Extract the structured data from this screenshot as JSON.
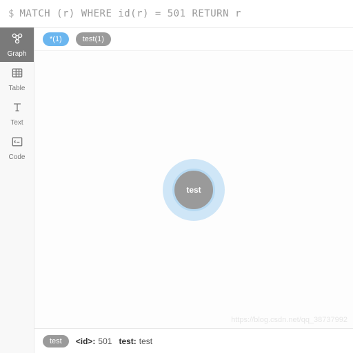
{
  "query": {
    "prompt": "$",
    "text": "MATCH (r) WHERE id(r) = 501 RETURN r"
  },
  "sidebar": {
    "items": [
      {
        "label": "Graph"
      },
      {
        "label": "Table"
      },
      {
        "label": "Text"
      },
      {
        "label": "Code"
      }
    ]
  },
  "chips": {
    "all": "*(1)",
    "label": "test(1)"
  },
  "node": {
    "label": "test"
  },
  "footer": {
    "label_chip": "test",
    "id_key": "<id>:",
    "id_val": "501",
    "prop_key": "test:",
    "prop_val": "test"
  },
  "watermark": "https://blog.csdn.net/qq_38737992",
  "colors": {
    "chip_blue": "#6bb6ef",
    "chip_gray": "#9a9a9a",
    "node_halo": "#cfe6f7",
    "node_fill": "#9a9a9a"
  }
}
